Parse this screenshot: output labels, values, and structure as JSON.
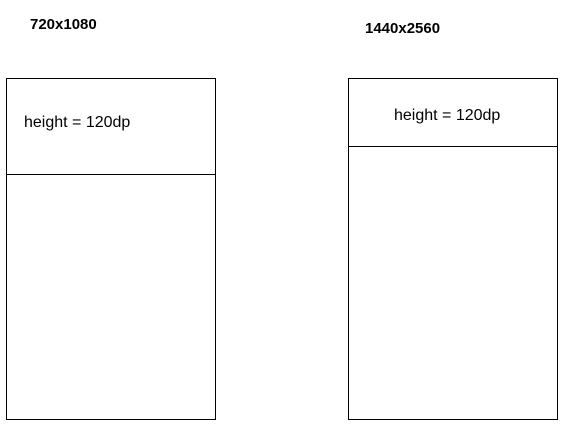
{
  "left": {
    "resolution": "720x1080",
    "header_label": "height = 120dp"
  },
  "right": {
    "resolution": "1440x2560",
    "header_label": "height = 120dp"
  }
}
